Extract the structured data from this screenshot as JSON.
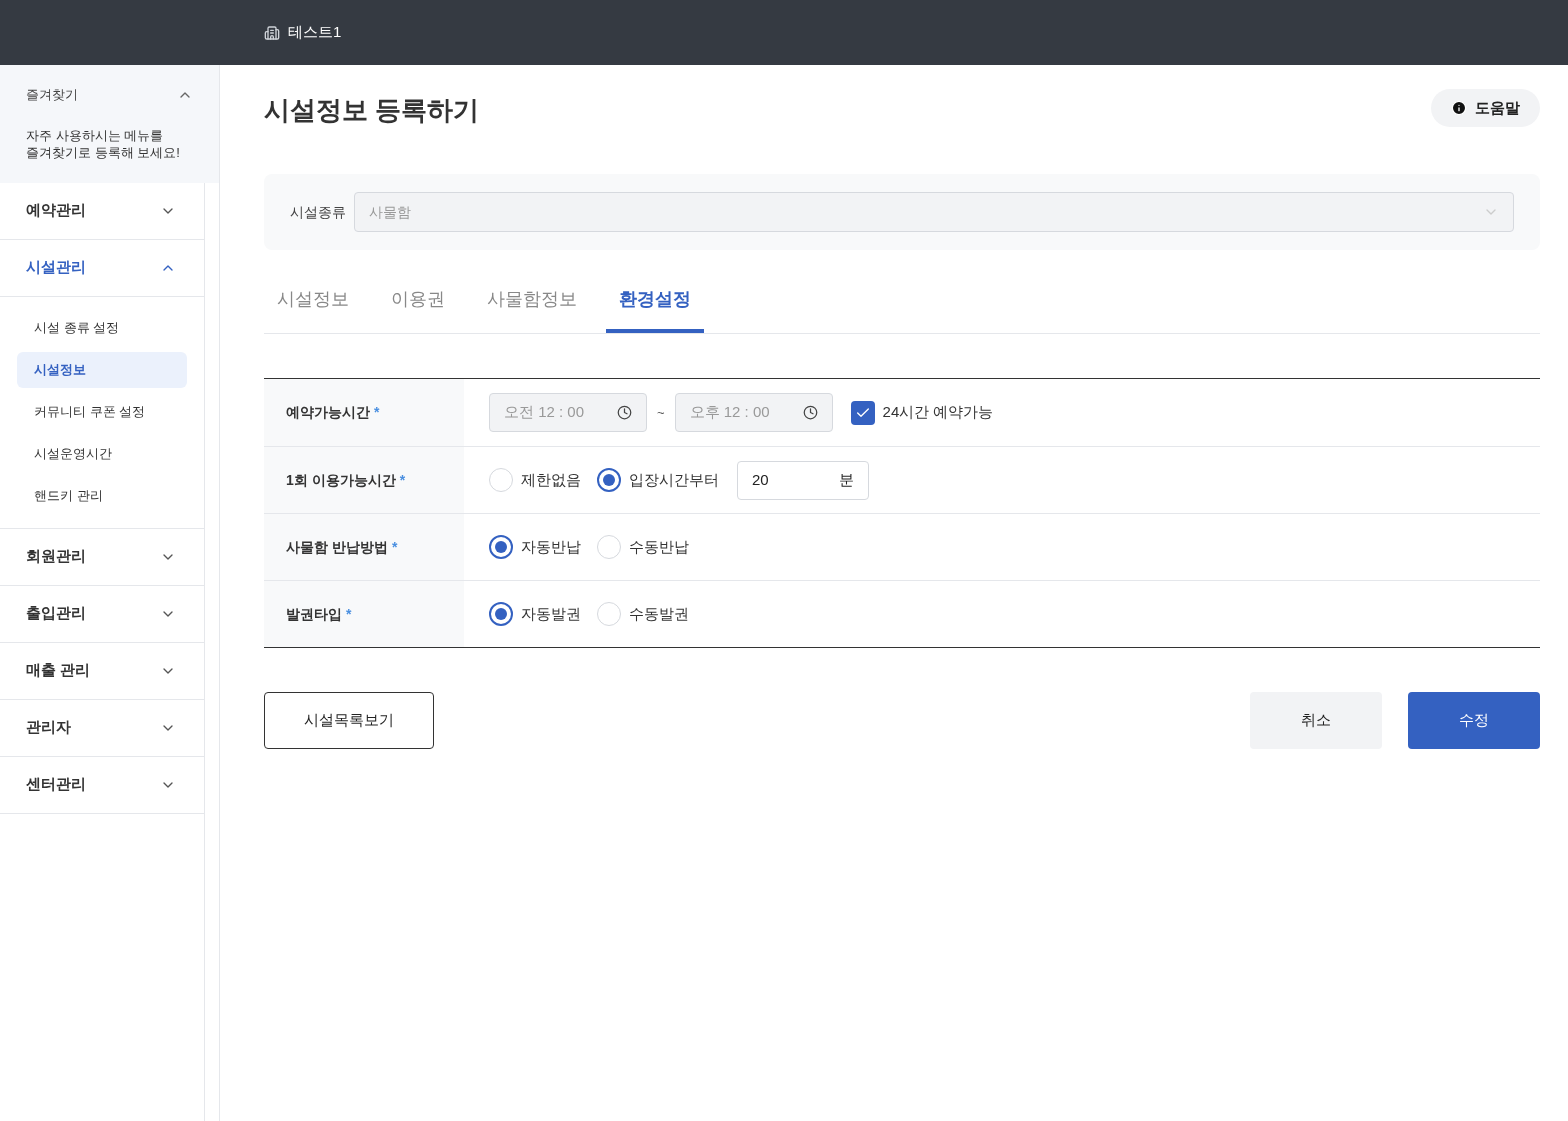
{
  "header": {
    "title": "테스트1"
  },
  "sidebar": {
    "favorites": {
      "title": "즐겨찾기",
      "expanded": true,
      "description": "자주 사용하시는 메뉴를\n즐겨찾기로 등록해 보세요!"
    },
    "menu": [
      {
        "label": "예약관리",
        "expanded": false,
        "selected": false
      },
      {
        "label": "시설관리",
        "expanded": true,
        "selected": true,
        "children": [
          {
            "label": "시설 종류 설정",
            "selected": false
          },
          {
            "label": "시설정보",
            "selected": true
          },
          {
            "label": "커뮤니티 쿠폰 설정",
            "selected": false
          },
          {
            "label": "시설운영시간",
            "selected": false
          },
          {
            "label": "핸드키 관리",
            "selected": false
          }
        ]
      },
      {
        "label": "회원관리",
        "expanded": false,
        "selected": false
      },
      {
        "label": "출입관리",
        "expanded": false,
        "selected": false
      },
      {
        "label": "매출 관리",
        "expanded": false,
        "selected": false
      },
      {
        "label": "관리자",
        "expanded": false,
        "selected": false
      },
      {
        "label": "센터관리",
        "expanded": false,
        "selected": false
      }
    ]
  },
  "page": {
    "title": "시설정보 등록하기",
    "help_button": "도움말"
  },
  "facility_type": {
    "label": "시설종류",
    "value": "사물함",
    "disabled": true
  },
  "tabs": [
    {
      "label": "시설정보",
      "selected": false
    },
    {
      "label": "이용권",
      "selected": false
    },
    {
      "label": "사물함정보",
      "selected": false
    },
    {
      "label": "환경설정",
      "selected": true
    }
  ],
  "form_rows": [
    {
      "kind": "time_range",
      "label": "예약가능시간",
      "required_mark": "*",
      "start": "오전 12 : 00",
      "separator": "~",
      "end": "오후 12 : 00",
      "disabled": true,
      "checkbox": {
        "label": "24시간 예약가능",
        "checked": true
      }
    },
    {
      "kind": "radio",
      "label": "1회 이용가능시간",
      "required_mark": "*",
      "options": [
        {
          "label": "제한없음",
          "selected": false
        },
        {
          "label": "입장시간부터",
          "selected": true
        }
      ],
      "minutes_field": {
        "value": "20",
        "unit": "분"
      }
    },
    {
      "kind": "radio",
      "label": "사물함 반납방법",
      "required_mark": "*",
      "options": [
        {
          "label": "자동반납",
          "selected": true
        },
        {
          "label": "수동반납",
          "selected": false
        }
      ]
    },
    {
      "kind": "radio",
      "label": "발권타입",
      "required_mark": "*",
      "options": [
        {
          "label": "자동발권",
          "selected": true
        },
        {
          "label": "수동발권",
          "selected": false
        }
      ]
    }
  ],
  "buttons": {
    "list": "시설목록보기",
    "cancel": "취소",
    "submit": "수정"
  }
}
